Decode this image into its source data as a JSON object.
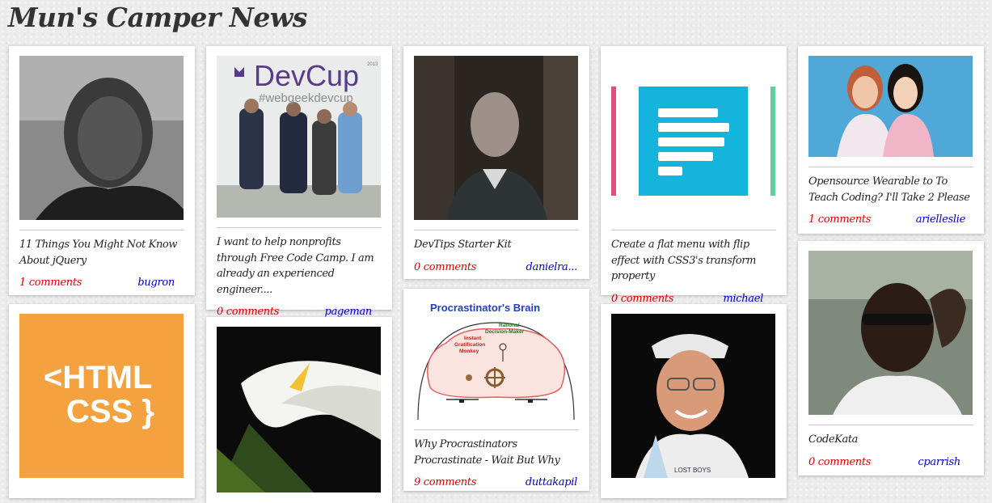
{
  "site": {
    "title": "Mun's Camper News"
  },
  "cards": [
    {
      "headline": "11 Things You Might Not Know About jQuery",
      "comments": "1 comments",
      "author": "bugron"
    },
    {
      "headline": "I want to help nonprofits through Free Code Camp. I am already an experienced engineer....",
      "comments": "0 comments",
      "author": "pageman",
      "image_text": [
        "DevCup",
        "#webgeekdevcup",
        "2013"
      ]
    },
    {
      "headline": "DevTips Starter Kit",
      "comments": "0 comments",
      "author": "danielra..."
    },
    {
      "headline": "Create a flat menu with flip effect with CSS3's transform property",
      "comments": "0 comments",
      "author": "michael"
    },
    {
      "headline": "Opensource Wearable to To Teach Coding? I'll Take 2 Please",
      "comments": "1 comments",
      "author": "arielleslie"
    },
    {
      "headline": "Why Procrastinators Procrastinate - Wait But Why",
      "comments": "9 comments",
      "author": "duttakapil",
      "image_text": [
        "Procrastinator's Brain",
        "Rational",
        "Decision-Maker",
        "Instant",
        "Gratification",
        "Monkey"
      ]
    },
    {
      "headline": "CodeKata",
      "comments": "0 comments",
      "author": "cparrish"
    },
    {
      "image_text": [
        "<HTML",
        "CSS }"
      ]
    },
    {
      "image_text": [
        "LOST BOYS"
      ]
    }
  ],
  "colors": {
    "comments": "#e00000",
    "author": "#0000cc",
    "html_css_bg": "#f4a23f",
    "menu_icon_bg": "#15b4dc"
  }
}
